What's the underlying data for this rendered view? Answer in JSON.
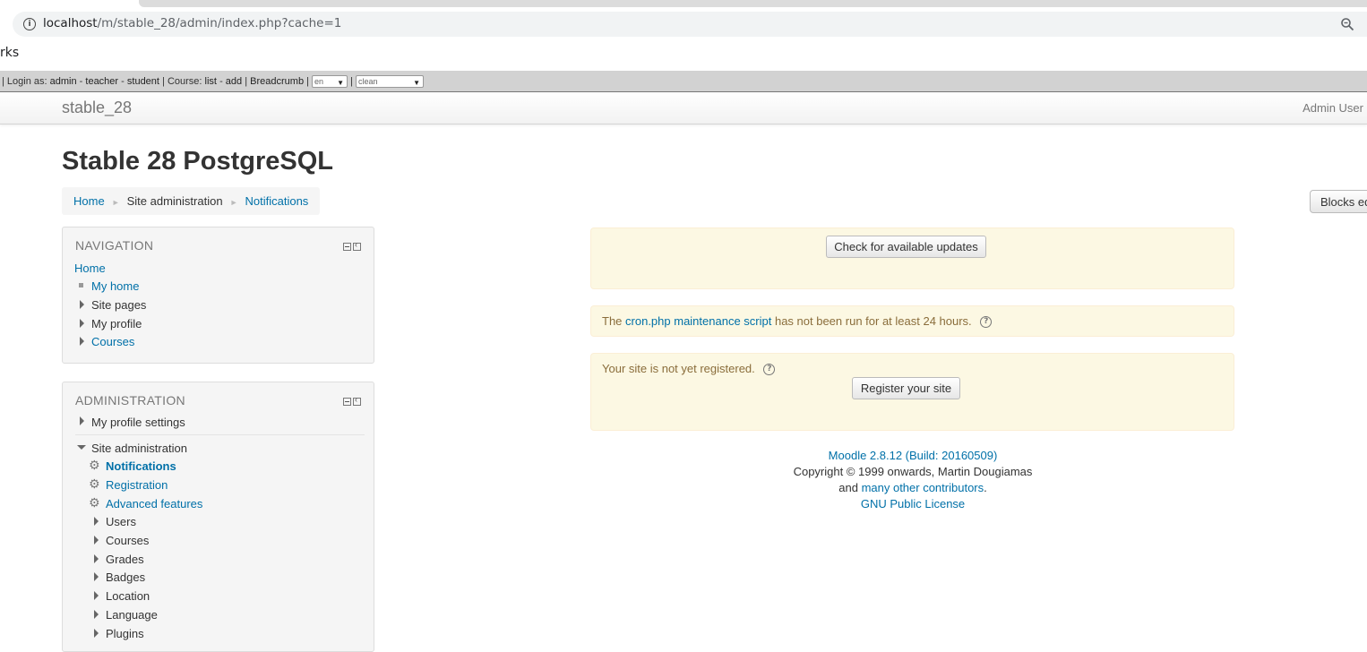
{
  "browser": {
    "url_host": "localhost",
    "url_path": "/m/stable_28/admin/index.php?cache=1",
    "bookmarks_fragment": "rks"
  },
  "devbar": {
    "prefix": "| Login as:",
    "admin": "admin",
    "sep1": "-",
    "teacher": "teacher",
    "sep2": "-",
    "student": "student",
    "course_label": "| Course:",
    "list": "list",
    "sep3": "-",
    "add": "add",
    "sep4": "|",
    "breadcrumb": "Breadcrumb",
    "sep5": "|",
    "lang": "en",
    "sep6": "|",
    "theme": "clean"
  },
  "navbar": {
    "brand": "stable_28",
    "user": "Admin User"
  },
  "header": {
    "title": "Stable 28 PostgreSQL",
    "breadcrumb": [
      "Home",
      "Site administration",
      "Notifications"
    ],
    "blocks_button": "Blocks editing on"
  },
  "navigation": {
    "title": "NAVIGATION",
    "home": "Home",
    "items": [
      "My home",
      "Site pages",
      "My profile",
      "Courses"
    ]
  },
  "administration": {
    "title": "ADMINISTRATION",
    "profile_settings": "My profile settings",
    "site_admin": "Site administration",
    "gear_items": [
      "Notifications",
      "Registration",
      "Advanced features"
    ],
    "sub_items": [
      "Users",
      "Courses",
      "Grades",
      "Badges",
      "Location",
      "Language",
      "Plugins"
    ]
  },
  "main": {
    "check_updates": "Check for available updates",
    "cron_pre": "The",
    "cron_link": "cron.php maintenance script",
    "cron_post": "has not been run for at least 24 hours.",
    "registration_text": "Your site is not yet registered.",
    "register_button": "Register your site"
  },
  "footer": {
    "version": "Moodle 2.8.12 (Build: 20160509)",
    "copyright": "Copyright © 1999 onwards, Martin Dougiamas",
    "and": "and",
    "contributors": "many other contributors",
    "period": ".",
    "license": "GNU Public License"
  }
}
